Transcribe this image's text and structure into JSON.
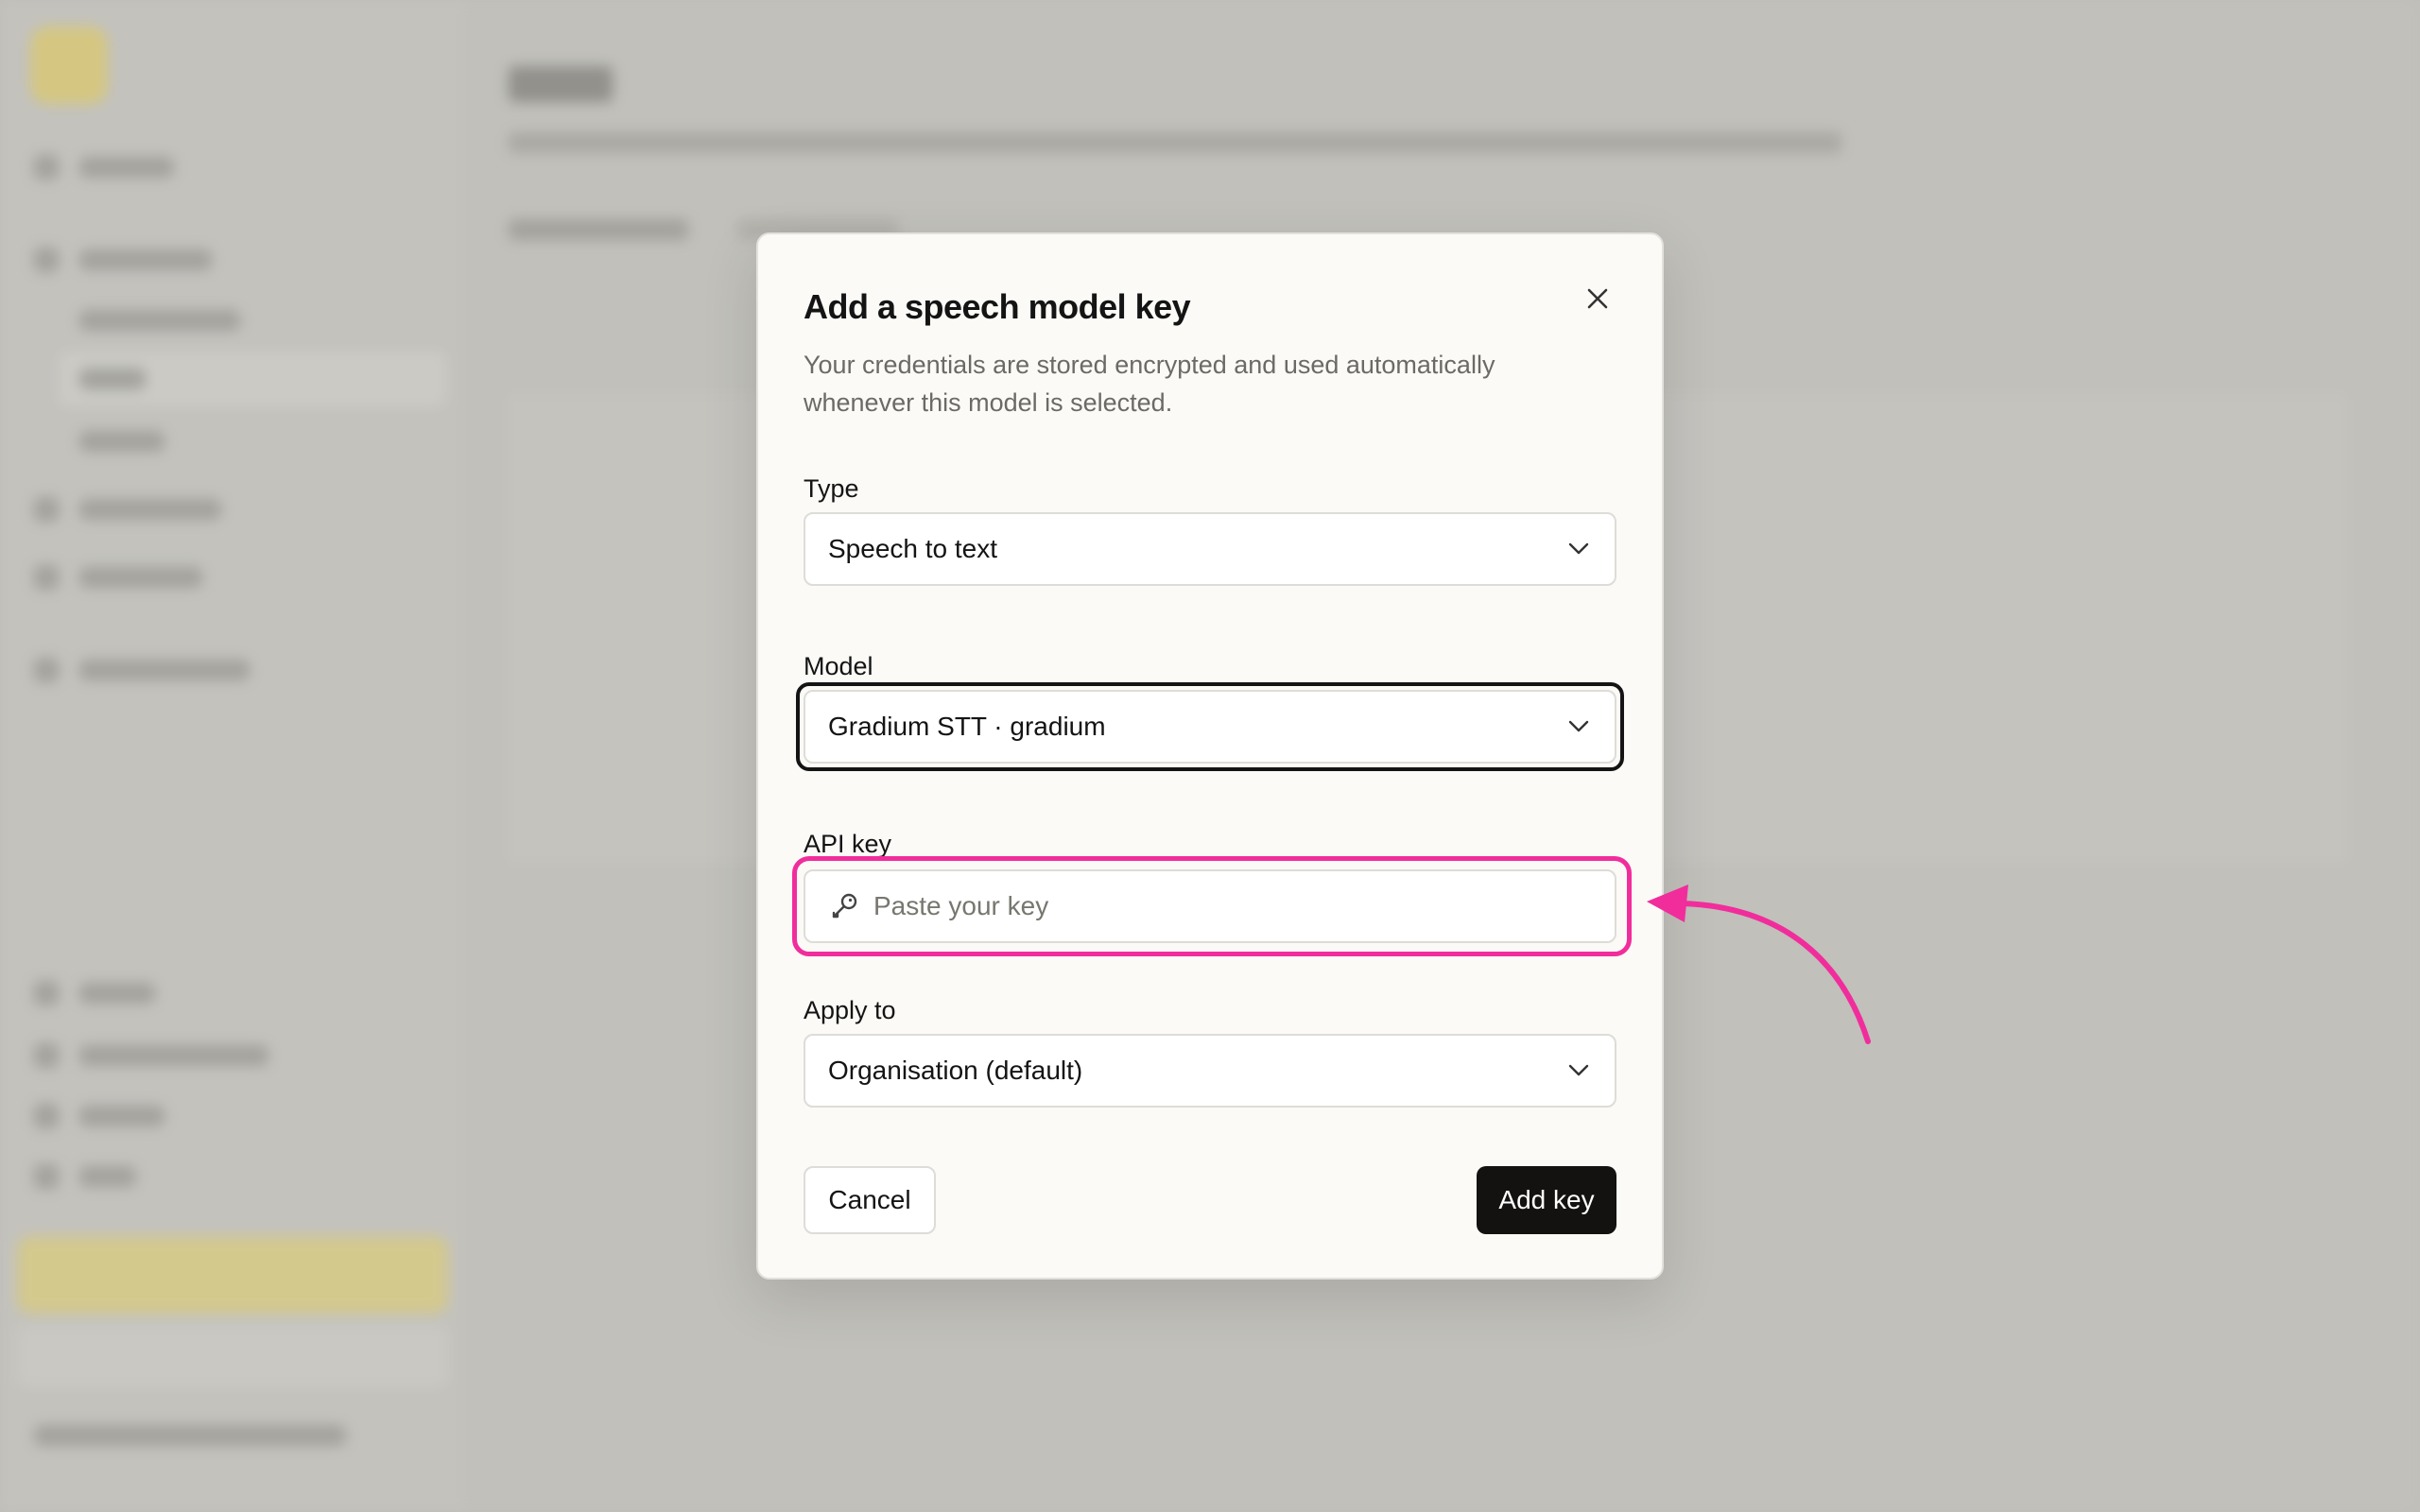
{
  "dialog": {
    "title": "Add a speech model key",
    "description": "Your credentials are stored encrypted and used automatically whenever this model is selected.",
    "fields": {
      "type": {
        "label": "Type",
        "value": "Speech to text"
      },
      "model": {
        "label": "Model",
        "value": "Gradium STT · gradium"
      },
      "api_key": {
        "label": "API key",
        "placeholder": "Paste your key",
        "value": ""
      },
      "apply_to": {
        "label": "Apply to",
        "value": "Organisation (default)"
      }
    },
    "actions": {
      "cancel_label": "Cancel",
      "submit_label": "Add key"
    }
  },
  "annotation": {
    "highlight_color": "#f12d9c"
  },
  "colors": {
    "primary_button": "#141210",
    "logo_yellow": "#e8cf55"
  },
  "icons": {
    "close": "close-icon",
    "chevron": "chevron-down-icon",
    "key": "key-icon"
  }
}
